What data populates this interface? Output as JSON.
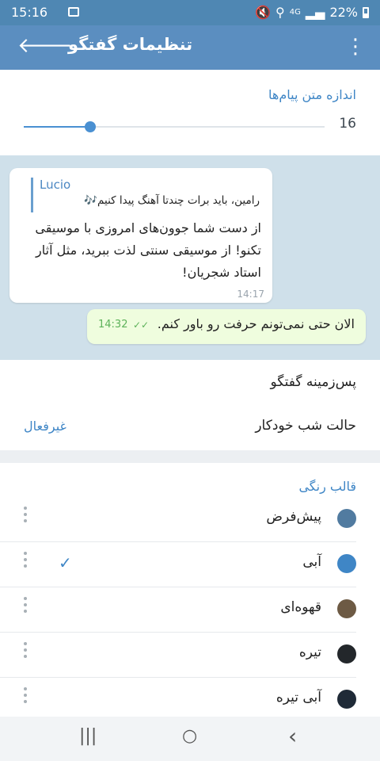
{
  "status_bar": {
    "time": "15:16",
    "network": "4G",
    "battery": "22%",
    "icons": [
      "gallery-icon",
      "mute-icon",
      "location-icon",
      "signal-icon",
      "battery-icon"
    ]
  },
  "app_bar": {
    "title": "تنظیمات گفتگو",
    "back_icon": "back-arrow-icon",
    "more_icon": "more-vert-icon",
    "color": "#5b8ec0"
  },
  "text_size": {
    "label": "اندازه متن پیام‌ها",
    "value": "16",
    "level": 0.22
  },
  "preview": {
    "incoming": {
      "sender": "Lucio",
      "reply_text": "رامین، باید برات چندتا آهنگ پیدا کنیم🎶",
      "message": "از دست شما جوون‌های امروزی با موسیقی تکنو! از موسیقی سنتی لذت ببرید، مثل آثار استاد شجریان!",
      "time": "14:17"
    },
    "outgoing": {
      "message": "الان حتی نمی‌تونم حرفت رو باور کنم.",
      "time": "14:32",
      "status_icon": "double-check-icon"
    },
    "background_color": "#cfe0ea"
  },
  "settings": {
    "chat_background": "پس‌زمینه گفتگو",
    "auto_night_mode": {
      "label": "حالت شب خودکار",
      "value": "غیرفعال"
    }
  },
  "themes": {
    "label": "قالب رنگی",
    "items": [
      {
        "name": "پیش‌فرض",
        "color": "#517ba0",
        "selected": false
      },
      {
        "name": "آبی",
        "color": "#3f86c6",
        "selected": true
      },
      {
        "name": "قهوه‌ای",
        "color": "#6d5a44",
        "selected": false
      },
      {
        "name": "تیره",
        "color": "#23272b",
        "selected": false
      },
      {
        "name": "آبی تیره",
        "color": "#1f2a37",
        "selected": false
      }
    ]
  },
  "nav_bar": {
    "recents": "|||",
    "home": "○",
    "back": "‹"
  },
  "colors": {
    "accent": "#3f86c6",
    "check_green": "#5db25a"
  }
}
